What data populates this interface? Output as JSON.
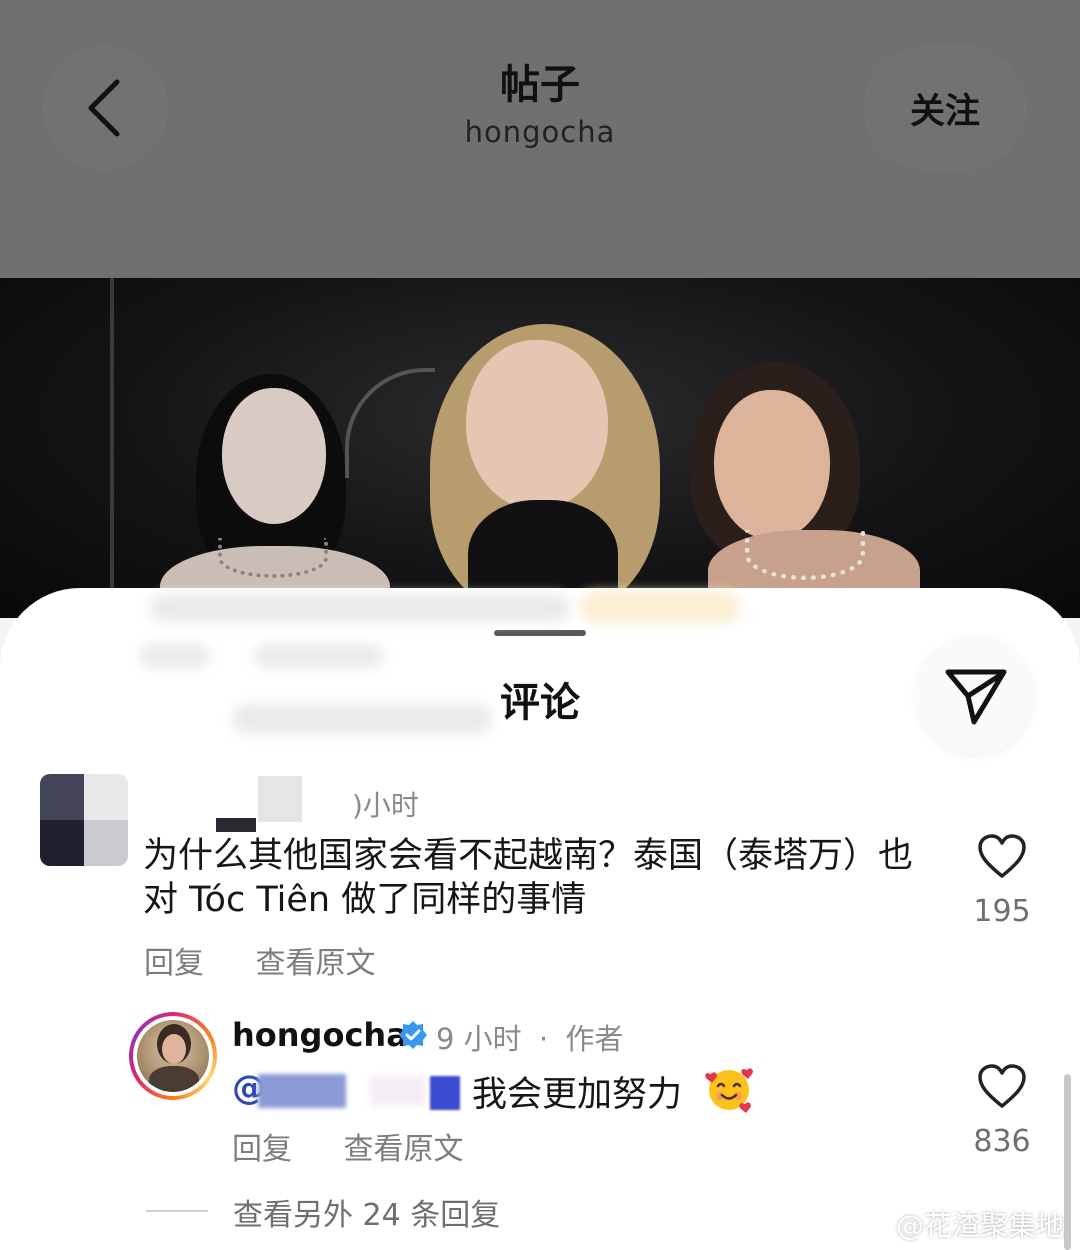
{
  "header": {
    "title": "帖子",
    "username": "hongocha",
    "follow_label": "关注"
  },
  "sheet": {
    "title": "评论"
  },
  "comment": {
    "time_fragment": ")小时",
    "text": "为什么其他国家会看不起越南？泰国（泰塔万）也对 Tóc Tiên 做了同样的事情",
    "reply_label": "回复",
    "translate_label": "查看原文",
    "likes": "195"
  },
  "reply": {
    "username": "hongocha",
    "time": "9 小时",
    "separator": "·",
    "role": "作者",
    "mention_prefix": "@",
    "text": "我会更加努力",
    "reply_label": "回复",
    "translate_label": "查看原文",
    "likes": "836",
    "more_replies": "查看另外 24 条回复"
  },
  "watermark": "@花渣聚集地",
  "colors": {
    "header_bg": "#6f7072",
    "verified": "#3897f0",
    "mention": "#2f4ab3"
  }
}
